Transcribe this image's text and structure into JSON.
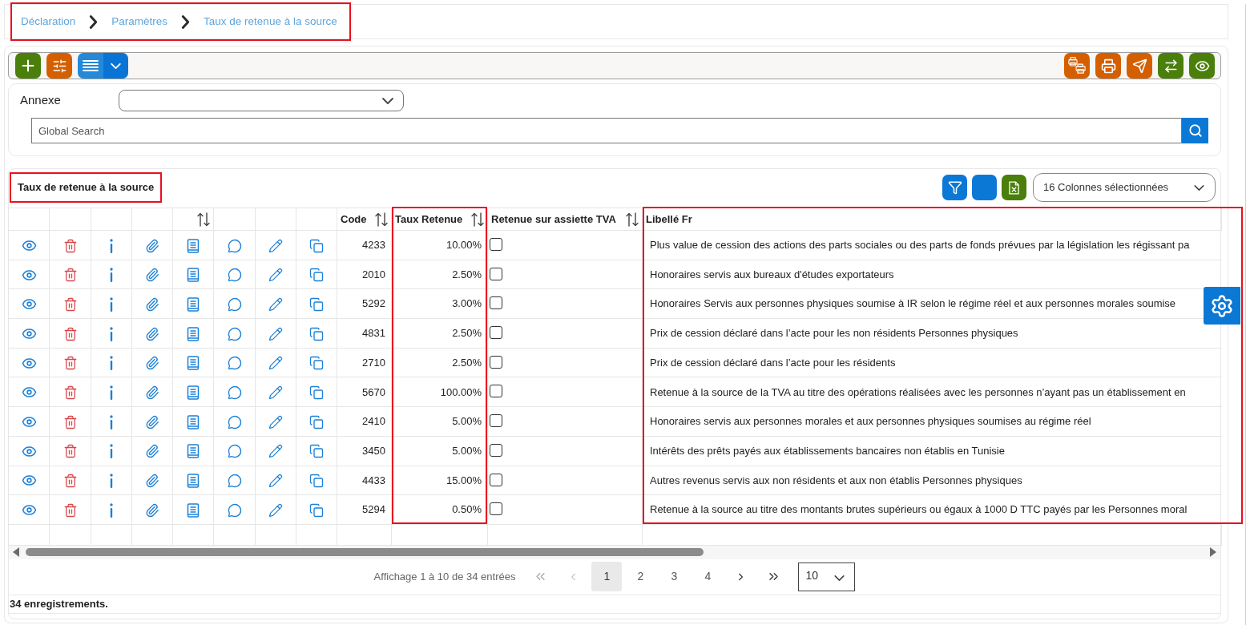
{
  "breadcrumb": {
    "highlighted": true,
    "items": [
      "Déclaration",
      "Paramètres",
      "Taux de retenue à la source"
    ]
  },
  "toolbar": {
    "left": [
      {
        "kind": "add",
        "color": "#4a7f0b",
        "dropdown": false
      },
      {
        "kind": "sliders",
        "color": "#d45f00",
        "dropdown": false
      },
      {
        "kind": "list",
        "color": "#2489d9",
        "dropdown": true
      }
    ],
    "right": [
      {
        "kind": "printers",
        "color": "#d45f00"
      },
      {
        "kind": "print",
        "color": "#d45f00"
      },
      {
        "kind": "send",
        "color": "#d45f00"
      },
      {
        "kind": "swap",
        "color": "#4a7f0b"
      },
      {
        "kind": "view",
        "color": "#4a7f0b"
      }
    ]
  },
  "filters": {
    "annexe": {
      "label": "Annexe"
    },
    "search": {
      "placeholder": "Global Search"
    }
  },
  "table": {
    "title": "Taux de retenue à la source",
    "title_highlighted": true,
    "tools": [
      {
        "kind": "filter",
        "color": "#0b78d6"
      },
      {
        "kind": "blank",
        "color": "#0b78d6"
      },
      {
        "kind": "excel",
        "color": "#4a7f0b"
      }
    ],
    "column_picker": "16 Colonnes sélectionnées",
    "columns": [
      {
        "kind": "eye",
        "sortable": false,
        "highlighted": false
      },
      {
        "kind": "trash",
        "sortable": false,
        "highlighted": false
      },
      {
        "kind": "info",
        "sortable": false,
        "highlighted": false
      },
      {
        "kind": "paperclip",
        "sortable": false,
        "highlighted": false
      },
      {
        "kind": "document",
        "sortable": true,
        "highlighted": false
      },
      {
        "kind": "chat",
        "sortable": false,
        "highlighted": false
      },
      {
        "kind": "pencil",
        "sortable": false,
        "highlighted": false
      },
      {
        "kind": "copy",
        "sortable": false,
        "highlighted": false
      },
      {
        "kind": "number",
        "label": "Code",
        "sortable": true,
        "highlighted": false
      },
      {
        "kind": "number",
        "label": "Taux Retenue",
        "sortable": true,
        "highlighted": true
      },
      {
        "kind": "checkbox",
        "label": "Retenue sur assiette TVA",
        "sortable": true,
        "highlighted": false
      },
      {
        "kind": "text",
        "label": "Libellé Fr",
        "sortable": false,
        "highlighted": true
      }
    ],
    "rows": [
      {
        "cells": [
          "4233",
          "10.00%",
          {
            "checked": false
          },
          "Plus value de cession des actions des parts sociales ou des parts de fonds prévues par la législation les régissant pa"
        ]
      },
      {
        "cells": [
          "2010",
          "2.50%",
          {
            "checked": false
          },
          "Honoraires servis aux bureaux d'études exportateurs"
        ]
      },
      {
        "cells": [
          "5292",
          "3.00%",
          {
            "checked": false
          },
          "Honoraires Servis aux personnes physiques soumise à IR selon le régime réel et aux personnes morales soumise"
        ]
      },
      {
        "cells": [
          "4831",
          "2.50%",
          {
            "checked": false
          },
          "Prix de cession déclaré dans l’acte pour les non résidents Personnes physiques"
        ]
      },
      {
        "cells": [
          "2710",
          "2.50%",
          {
            "checked": false
          },
          "Prix de cession déclaré dans l’acte pour les résidents"
        ]
      },
      {
        "cells": [
          "5670",
          "100.00%",
          {
            "checked": false
          },
          "Retenue à la source de la TVA au titre des opérations réalisées avec les personnes n’ayant pas un établissement en"
        ]
      },
      {
        "cells": [
          "2410",
          "5.00%",
          {
            "checked": false
          },
          "Honoraires servis aux personnes morales et aux personnes physiques soumises au régime réel"
        ]
      },
      {
        "cells": [
          "3450",
          "5.00%",
          {
            "checked": false
          },
          "Intérêts des prêts payés aux établissements bancaires non établis en Tunisie"
        ]
      },
      {
        "cells": [
          "4433",
          "15.00%",
          {
            "checked": false
          },
          "Autres revenus servis aux non résidents et aux non établis Personnes physiques"
        ]
      },
      {
        "cells": [
          "5294",
          "0.50%",
          {
            "checked": false
          },
          "Retenue à la source au titre des montants brutes supérieurs ou égaux à 1000 D TTC payés par les Personnes moral"
        ]
      }
    ]
  },
  "pagination": {
    "summary": "Affichage 1 à 10 de 34 entrées",
    "back": [
      {
        "kind": "first",
        "disabled": true
      },
      {
        "kind": "previous",
        "disabled": true
      }
    ],
    "pages": [
      {
        "label": "1",
        "selected": true
      },
      {
        "label": "2",
        "selected": false
      },
      {
        "label": "3",
        "selected": false
      },
      {
        "label": "4",
        "selected": false
      }
    ],
    "forward": [
      {
        "kind": "next",
        "disabled": false
      },
      {
        "kind": "last",
        "disabled": false
      }
    ],
    "page_size": "10"
  },
  "footer": {
    "count": "34 enregistrements."
  }
}
